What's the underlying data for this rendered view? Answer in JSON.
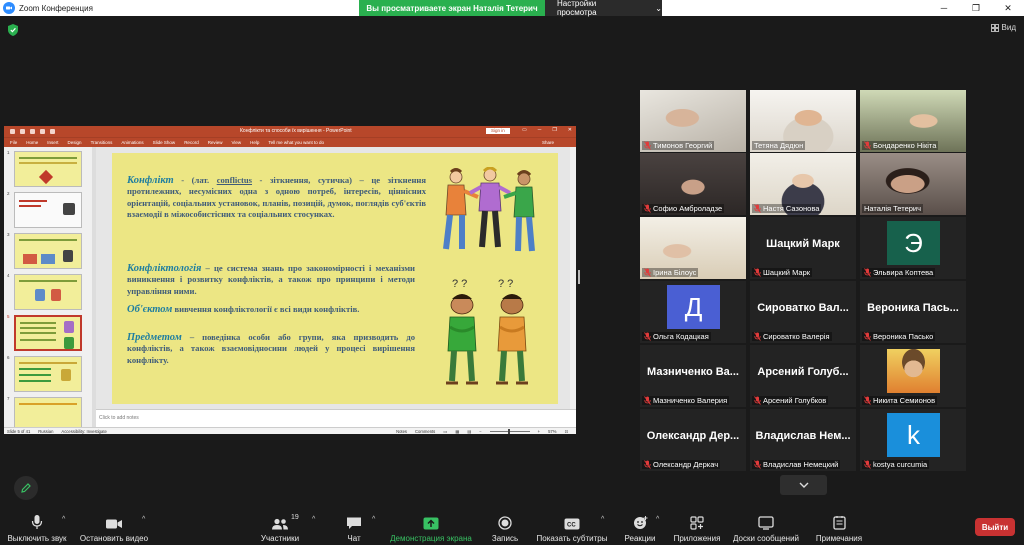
{
  "window": {
    "title": "Zoom Конференция",
    "share_banner": "Вы просматриваете экран Наталія Тетерич",
    "view_options": "Настройки просмотра",
    "view_button": "Вид"
  },
  "ppt": {
    "doc_title": "Конфлікти та способи їх вирішення  -  PowerPoint",
    "sign_in": "Sign in",
    "ribbon_tabs": [
      "File",
      "Home",
      "Insert",
      "Design",
      "Transitions",
      "Animations",
      "Slide Show",
      "Record",
      "Review",
      "View",
      "Help",
      "Tell me what you want to do"
    ],
    "share": "Share",
    "notes_placeholder": "Click to add notes",
    "status": {
      "slide": "Slide 5 of 41",
      "language": "Russian",
      "accessibility": "Accessibility: Investigate",
      "notes": "Notes",
      "comments": "Comments",
      "zoom": "57%"
    },
    "thumb_numbers": [
      "1",
      "2",
      "3",
      "4",
      "5",
      "6",
      "7"
    ],
    "selected_thumb": 5,
    "slide": {
      "p1_term": "Конфлікт",
      "p1_a": " - (лат. ",
      "p1_latin": "conflictus",
      "p1_b": " - зіткнення, сутичка) – це зіткнення протилежних, несумісних одна з одною потреб, інтересів, ціннісних орієнтацій, соціальних установок, планів, позицій, думок, поглядів суб'єктів взаємодії в міжособистісних та соціальних стосунках.",
      "p2_term": "Конфліктологія",
      "p2_text": " – це система знань про закономірності і механізми виникнення і розвитку конфліктів, а також про принципи і методи управління ними.",
      "p3_term": "Об'єктом",
      "p3_text": " вивчення конфліктології є всі види конфліктів.",
      "p4_term": "Предметом",
      "p4_text": " – поведінка особи або групи, яка призводить до конфліктів, а також взаємовідносини людей у процесі вирішення конфлікту."
    }
  },
  "participants": [
    {
      "name": "Тимонов Георгий",
      "type": "video",
      "muted": true
    },
    {
      "name": "Тетяна Дядюн",
      "type": "video",
      "muted": false
    },
    {
      "name": "Бондаренко Нікіта",
      "type": "video",
      "muted": true
    },
    {
      "name": "Софио Амброладзе",
      "type": "video",
      "muted": true
    },
    {
      "name": "Настя Сазонова",
      "type": "video",
      "muted": true
    },
    {
      "name": "Наталія Тетерич",
      "type": "video",
      "muted": false,
      "active": true
    },
    {
      "name": "Ірина Білоус",
      "type": "video",
      "muted": true
    },
    {
      "name": "Шацкий Марк",
      "type": "text",
      "big": "Шацкий Марк",
      "muted": true
    },
    {
      "name": "Эльвира Коптева",
      "type": "avatar",
      "letter": "Э",
      "color": "#17614c",
      "muted": true
    },
    {
      "name": "Ольга Кодацкая",
      "type": "avatar",
      "letter": "Д",
      "color": "#4a5fd3",
      "muted": true
    },
    {
      "name": "Сироватко Валерія",
      "type": "text",
      "big": "Сироватко Вал...",
      "muted": true
    },
    {
      "name": "Вероника Пасько",
      "type": "text",
      "big": "Вероника Пась...",
      "muted": true
    },
    {
      "name": "Мазниченко Валерия",
      "type": "text",
      "big": "Мазниченко Ва...",
      "muted": true
    },
    {
      "name": "Арсений Голубков",
      "type": "text",
      "big": "Арсений Голуб...",
      "muted": true
    },
    {
      "name": "Никита Семионов",
      "type": "photo",
      "muted": true
    },
    {
      "name": "Олександр Деркач",
      "type": "text",
      "big": "Олександр Дер...",
      "muted": true
    },
    {
      "name": "Владислав Немецкий",
      "type": "text",
      "big": "Владислав Нем...",
      "muted": true
    },
    {
      "name": "kostya curcumia",
      "type": "avatar",
      "letter": "k",
      "color": "#1a8fdb",
      "muted": true
    }
  ],
  "toolbar": {
    "mute": "Выключить звук",
    "video": "Остановить видео",
    "participants": "Участники",
    "participants_count": "19",
    "chat": "Чат",
    "share": "Демонстрация экрана",
    "record": "Запись",
    "captions": "Показать субтитры",
    "reactions": "Реакции",
    "apps": "Приложения",
    "whiteboards": "Доски сообщений",
    "notes": "Примечания",
    "leave": "Выйти"
  },
  "colors": {
    "accent_green": "#2ab04f",
    "exit_red": "#c83232",
    "slide_bg": "#ece684",
    "ppt_red": "#b7472a"
  }
}
